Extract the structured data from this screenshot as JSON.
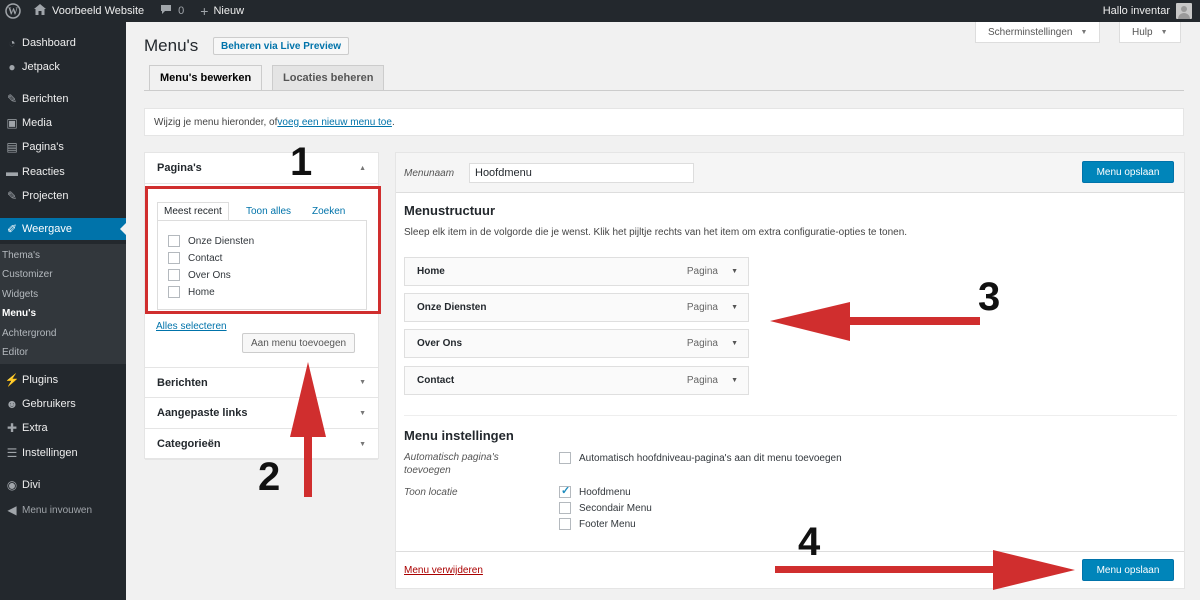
{
  "adminbar": {
    "site_name": "Voorbeeld Website",
    "comments_count": "0",
    "new_label": "Nieuw",
    "greeting": "Hallo inventar"
  },
  "sidebar": {
    "items": [
      {
        "label": "Dashboard",
        "icon": "dashboard-icon"
      },
      {
        "label": "Jetpack",
        "icon": "jetpack-icon"
      },
      {
        "label": "Berichten",
        "icon": "pin-icon"
      },
      {
        "label": "Media",
        "icon": "media-icon"
      },
      {
        "label": "Pagina's",
        "icon": "page-icon"
      },
      {
        "label": "Reacties",
        "icon": "comment-icon"
      },
      {
        "label": "Projecten",
        "icon": "pin-icon"
      },
      {
        "label": "Weergave",
        "icon": "brush-icon"
      },
      {
        "label": "Plugins",
        "icon": "plugin-icon"
      },
      {
        "label": "Gebruikers",
        "icon": "users-icon"
      },
      {
        "label": "Extra",
        "icon": "wrench-icon"
      },
      {
        "label": "Instellingen",
        "icon": "settings-icon"
      },
      {
        "label": "Divi",
        "icon": "divi-icon"
      },
      {
        "label": "Menu invouwen",
        "icon": "collapse-icon"
      }
    ],
    "submenu": [
      "Thema's",
      "Customizer",
      "Widgets",
      "Menu's",
      "Achtergrond",
      "Editor"
    ]
  },
  "header": {
    "title": "Menu's",
    "live_preview": "Beheren via Live Preview",
    "screen_options": "Scherminstellingen",
    "help": "Hulp"
  },
  "tabs": [
    "Menu's bewerken",
    "Locaties beheren"
  ],
  "notice": {
    "text": "Wijzig je menu hieronder, of ",
    "link": "voeg een nieuw menu toe",
    "suffix": "."
  },
  "accordion": {
    "pages_title": "Pagina's",
    "panel_tabs": [
      "Meest recent",
      "Toon alles",
      "Zoeken"
    ],
    "pages": [
      "Onze Diensten",
      "Contact",
      "Over Ons",
      "Home"
    ],
    "select_all": "Alles selecteren",
    "add_button": "Aan menu toevoegen",
    "sections": [
      "Berichten",
      "Aangepaste links",
      "Categorieën"
    ]
  },
  "menu": {
    "name_label": "Menunaam",
    "name_value": "Hoofdmenu",
    "save_label": "Menu opslaan",
    "structure_title": "Menustructuur",
    "structure_desc": "Sleep elk item in de volgorde die je wenst. Klik het pijltje rechts van het item om extra configuratie-opties te tonen.",
    "items": [
      {
        "title": "Home",
        "type": "Pagina"
      },
      {
        "title": "Onze Diensten",
        "type": "Pagina"
      },
      {
        "title": "Over Ons",
        "type": "Pagina"
      },
      {
        "title": "Contact",
        "type": "Pagina"
      }
    ],
    "settings_title": "Menu instellingen",
    "auto_add_label": "Automatisch pagina's toevoegen",
    "auto_add_option": "Automatisch hoofdniveau-pagina's aan dit menu toevoegen",
    "location_label": "Toon locatie",
    "locations": [
      {
        "label": "Hoofdmenu",
        "checked": true
      },
      {
        "label": "Secondair Menu",
        "checked": false
      },
      {
        "label": "Footer Menu",
        "checked": false
      }
    ],
    "delete_label": "Menu verwijderen"
  },
  "annotations": [
    "1",
    "2",
    "3",
    "4"
  ],
  "colors": {
    "accent": "#0073aa",
    "primary_button": "#0085ba",
    "annotation_red": "#d02e2e",
    "admin_dark": "#23282d"
  }
}
